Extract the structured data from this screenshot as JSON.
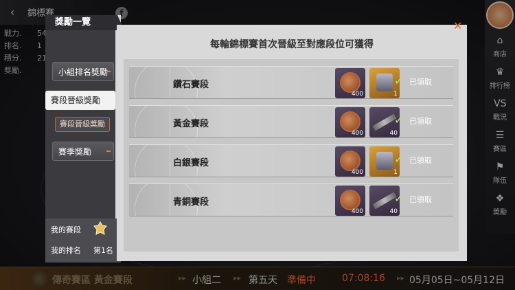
{
  "background": {
    "back_icon": "back-arrow-icon",
    "title": "錦標賽",
    "info_icon": "f",
    "stats": [
      {
        "label": "戰力",
        "value": "54"
      },
      {
        "label": "排名",
        "value": "1"
      },
      {
        "label": "積分",
        "value": "21"
      },
      {
        "label": "獎勵",
        "value": ""
      }
    ],
    "side_nav": [
      {
        "label": "商店",
        "icon": "shop-icon",
        "glyph": "⌂"
      },
      {
        "label": "排行榜",
        "icon": "trophy-icon",
        "glyph": "♛"
      },
      {
        "label": "戰況",
        "icon": "versus-icon",
        "glyph": "VS"
      },
      {
        "label": "賽區",
        "icon": "document-icon",
        "glyph": "☰"
      },
      {
        "label": "隊伍",
        "icon": "team-icon",
        "glyph": "⚑"
      },
      {
        "label": "獎勵",
        "icon": "gift-icon",
        "glyph": "❖"
      }
    ],
    "bottom": {
      "title": "傳奇賽區 黃金賽段",
      "group": "小組二",
      "day": "第五天",
      "status": "準備中",
      "timer": "07:08:16",
      "range": "05月05日~05月12日"
    }
  },
  "left_panel": {
    "title": "獎勵一覽",
    "tabs": [
      {
        "label": "小組排名獎勵"
      },
      {
        "label": "賽段晉級獎勵"
      },
      {
        "label": "賽季獎勵"
      }
    ],
    "sub_tab": "賽段晉級獎勵",
    "my_tier_label": "我的賽段",
    "my_rank_label": "我的排名",
    "my_rank_value": "第1名"
  },
  "main_panel": {
    "title": "每輪錦標賽首次晉級至對應段位可獲得",
    "close": "✕",
    "claimed_label": "已領取",
    "tiers": [
      {
        "name": "鑽石賽段",
        "coin_qty": "400",
        "item_qty": "1",
        "item_type": "chip"
      },
      {
        "name": "黃金賽段",
        "coin_qty": "400",
        "item_qty": "40",
        "item_type": "blade"
      },
      {
        "name": "白銀賽段",
        "coin_qty": "400",
        "item_qty": "1",
        "item_type": "chip"
      },
      {
        "name": "青銅賽段",
        "coin_qty": "400",
        "item_qty": "40",
        "item_type": "blade"
      }
    ]
  }
}
